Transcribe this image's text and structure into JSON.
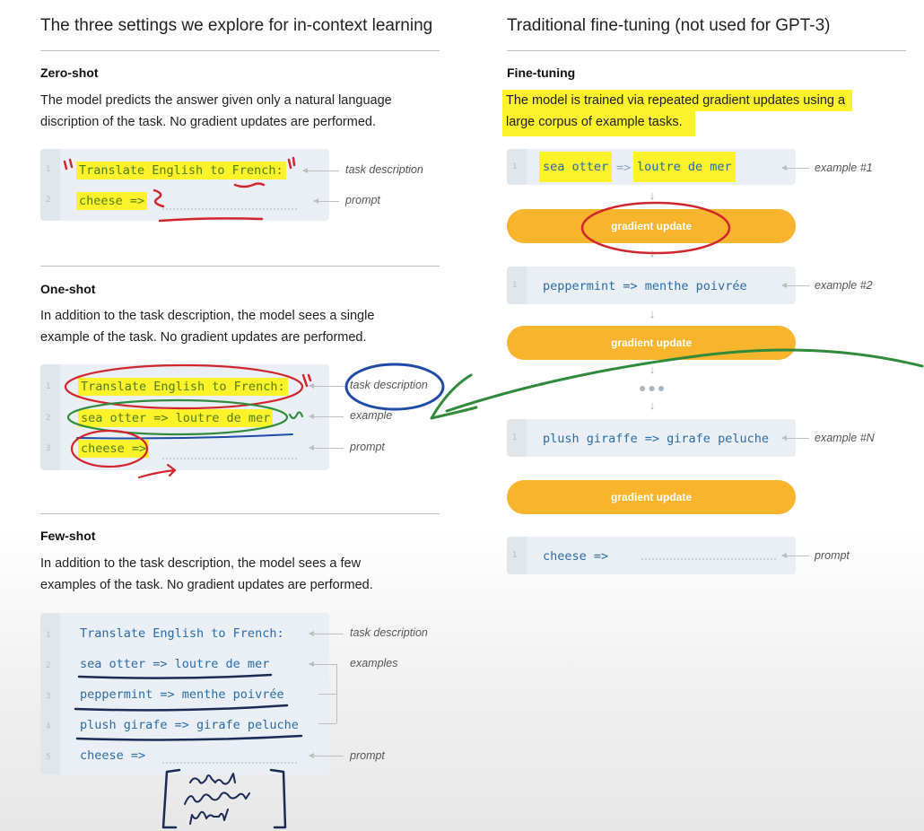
{
  "left_column": {
    "title": "The three settings we explore for in-context learning",
    "zero_shot": {
      "title": "Zero-shot",
      "description": [
        "The model predicts the answer given only a natural language",
        "discription of the task. No gradient updates are performed."
      ],
      "lines": [
        "Translate English to French:",
        "cheese =>"
      ],
      "annotations": [
        "task description",
        "prompt"
      ]
    },
    "one_shot": {
      "title": "One-shot",
      "description": [
        "In addition to the task description, the model sees a single",
        "example of the task. No gradient updates are performed."
      ],
      "lines": [
        "Translate English to French:",
        "sea otter => loutre de mer",
        "cheese =>"
      ],
      "annotations": [
        "task description",
        "example",
        "prompt"
      ]
    },
    "few_shot": {
      "title": "Few-shot",
      "description": [
        "In addition to the task description, the model sees a few",
        "examples of the task. No gradient updates are performed."
      ],
      "lines": [
        "Translate English to French:",
        "sea otter => loutre de mer",
        "peppermint => menthe poivrée",
        "plush girafe => girafe peluche",
        "cheese =>"
      ],
      "annotations": [
        "task description",
        "examples",
        "prompt"
      ]
    }
  },
  "right_column": {
    "title": "Traditional fine-tuning (not used for GPT-3)",
    "section_title": "Fine-tuning",
    "description": [
      "The model is trained via repeated gradient updates using a",
      "large corpus of example tasks."
    ],
    "examples": [
      {
        "code_left": "sea otter",
        "code_sep": "=>",
        "code_right": "loutre de mer",
        "annotation": "example #1"
      },
      {
        "code": "peppermint => menthe poivrée",
        "annotation": "example #2"
      },
      {
        "code": "plush giraffe => girafe peluche",
        "annotation": "example #N"
      }
    ],
    "gradient_label": "gradient update",
    "prompt": {
      "code": "cheese =>",
      "annotation": "prompt"
    }
  },
  "colors": {
    "highlight": "#fbf22a",
    "pill": "#f7b42c",
    "code_text": "#2a6aa6",
    "code_bg": "#e9eff4",
    "ink_red": "#d1252c",
    "ink_green": "#2f8a3b",
    "ink_blue": "#1f4aa8",
    "ink_navy": "#1b2a55"
  },
  "icons": [
    "arrow-down-icon",
    "ellipsis-icon",
    "annotation-arrow-icon"
  ]
}
